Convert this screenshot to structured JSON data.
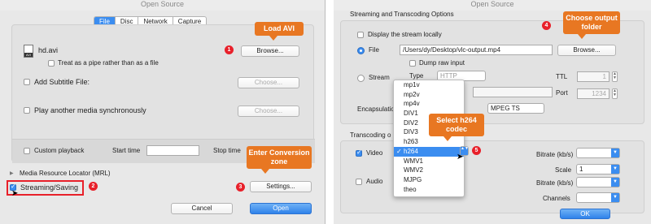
{
  "left": {
    "title": "Open Source",
    "tabs": [
      "File",
      "Disc",
      "Network",
      "Capture"
    ],
    "active_tab": "File",
    "file_name": "hd.avi",
    "file_icon_label": "AVI",
    "pipe_label": "Treat as a pipe rather than as a file",
    "browse_label": "Browse...",
    "subtitle_label": "Add Subtitle File:",
    "choose_label": "Choose...",
    "sync_label": "Play another media synchronously",
    "custom_playback_label": "Custom playback",
    "start_time_label": "Start time",
    "stop_time_label": "Stop time",
    "mrl_label": "Media Resource Locator (MRL)",
    "streaming_label": "Streaming/Saving",
    "settings_label": "Settings...",
    "cancel_label": "Cancel",
    "open_label": "Open"
  },
  "right": {
    "title": "Open Source",
    "section_title": "Streaming and Transcoding Options",
    "display_locally_label": "Display the stream locally",
    "file_label": "File",
    "file_path": "/Users/dy/Desktop/vlc-output.mp4",
    "browse_label": "Browse...",
    "dump_raw_label": "Dump raw input",
    "stream_label": "Stream",
    "type_label": "Type",
    "type_value": "HTTP",
    "ttl_label": "TTL",
    "ttl_value": "1",
    "port_label": "Port",
    "port_value": "1234",
    "encapsulation_label": "Encapsulation",
    "encapsulation_value": "MPEG TS",
    "transcoding_label": "Transcoding o",
    "video_label": "Video",
    "audio_label": "Audio",
    "bitrate_label": "Bitrate (kb/s)",
    "scale_label": "Scale",
    "scale_value": "1",
    "bitrate2_label": "Bitrate (kb/s)",
    "channels_label": "Channels",
    "ok_label": "OK",
    "codecs": [
      "mp1v",
      "mp2v",
      "mp4v",
      "DIV1",
      "DIV2",
      "DIV3",
      "h263",
      "h264",
      "WMV1",
      "WMV2",
      "MJPG",
      "theo"
    ],
    "selected_codec": "h264"
  },
  "callouts": {
    "c1": "Load AVI",
    "c2": "Enter Conversion zone",
    "c3": "Select h264 codec",
    "c4": "Choose output folder"
  },
  "steps": {
    "s1": "1",
    "s2": "2",
    "s3": "3",
    "s4": "4",
    "s5": "5"
  },
  "colors": {
    "accent": "#3b8df0",
    "callout": "#e87722",
    "step_badge": "#e8202a",
    "highlight_box": "#e8202a"
  }
}
